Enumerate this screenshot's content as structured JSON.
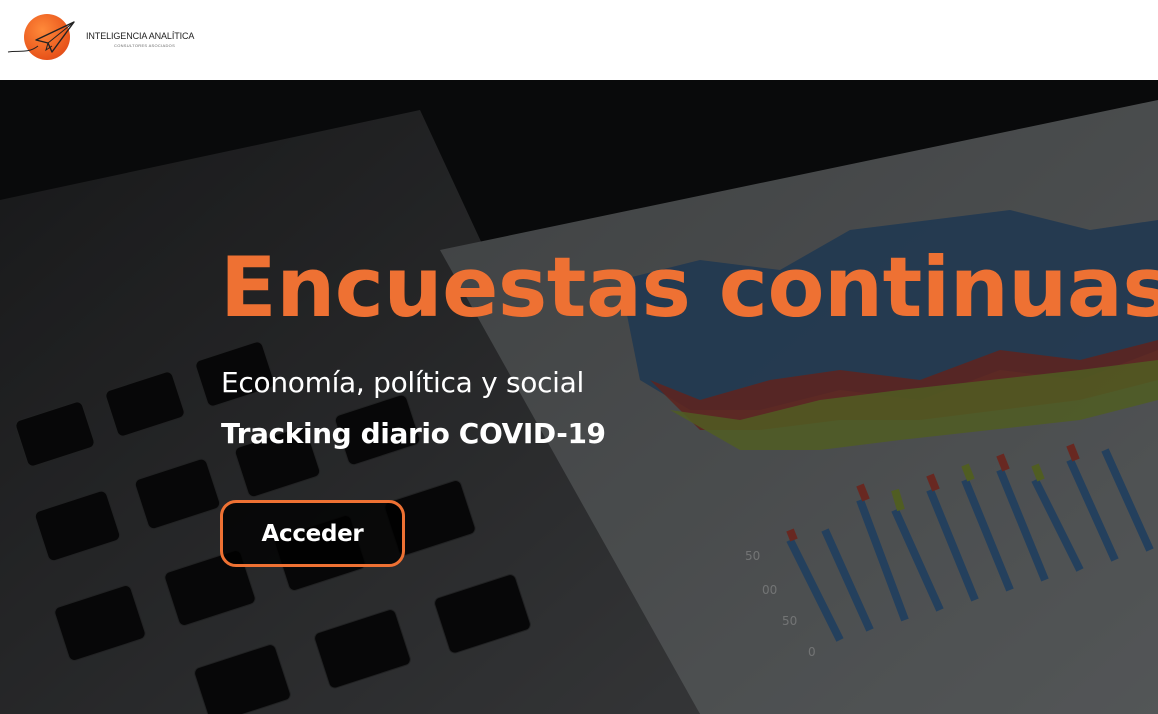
{
  "header": {
    "logo": {
      "name": "INTELIGENCIA ANALÍTICA",
      "tagline": "CONSULTORES ASOCIADOS",
      "icon": "paper-plane-sun-icon"
    }
  },
  "hero": {
    "title": "Encuestas continuas",
    "subtitle": "Economía, política y social",
    "highlight": "Tracking diario COVID-19",
    "cta_label": "Acceder",
    "background_icon": "laptop-and-charts-photo",
    "chart_axis_labels": [
      "50",
      "00",
      "50",
      "0"
    ]
  },
  "colors": {
    "accent": "#ee7133",
    "text_light": "#ffffff",
    "header_bg": "#ffffff",
    "hero_bg": "#1b1b1c"
  }
}
